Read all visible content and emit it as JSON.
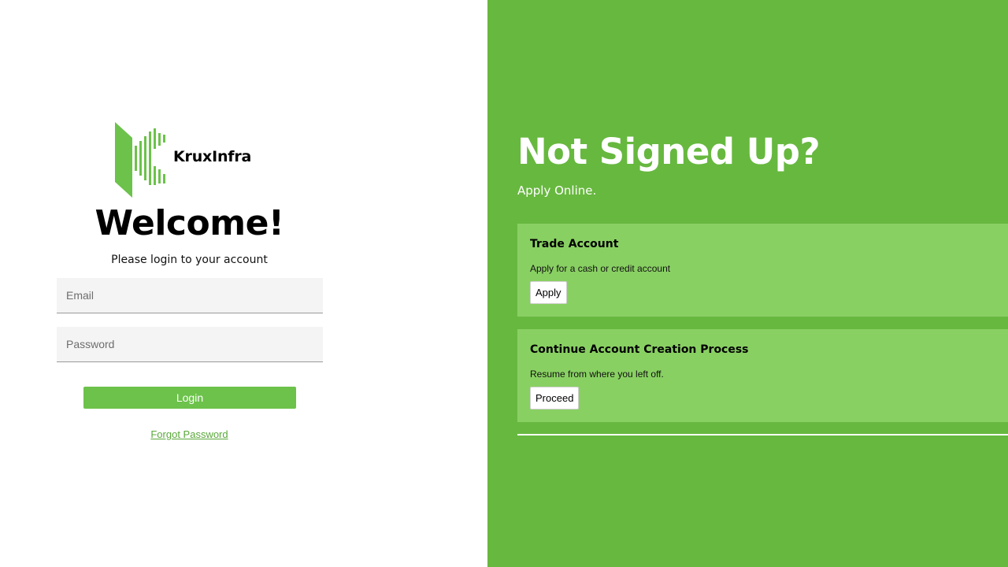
{
  "brand": {
    "name": "KruxInfra",
    "accent": "#6cc24a"
  },
  "login": {
    "heading": "Welcome!",
    "subtitle": "Please login to your account",
    "email_placeholder": "Email",
    "password_placeholder": "Password",
    "login_label": "Login",
    "forgot_label": "Forgot Password"
  },
  "signup": {
    "heading": "Not Signed Up?",
    "subheading": "Apply Online.",
    "background": "#67b83f",
    "cards": [
      {
        "title": "Trade Account",
        "description": "Apply for a cash or credit account",
        "button": "Apply"
      },
      {
        "title": "Continue Account Creation Process",
        "description": "Resume from where you left off.",
        "button": "Proceed"
      }
    ]
  }
}
